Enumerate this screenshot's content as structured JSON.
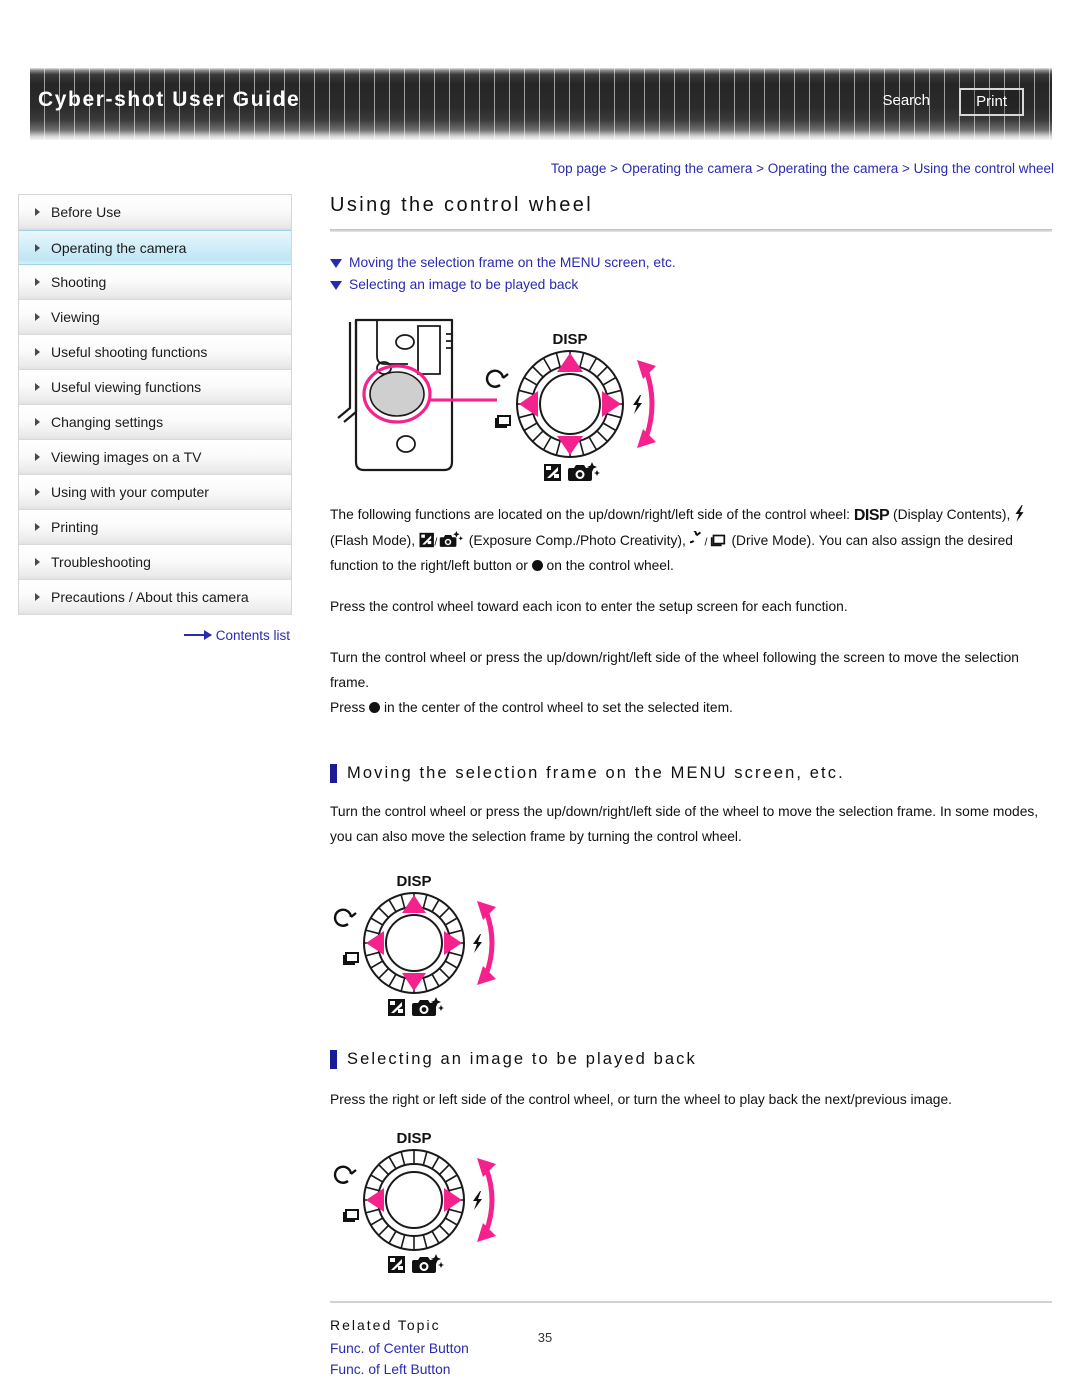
{
  "header": {
    "title": "Cyber-shot User Guide",
    "search_label": "Search",
    "print_label": "Print"
  },
  "breadcrumb": "Top page > Operating the camera > Operating the camera > Using the control wheel",
  "sidebar": {
    "items": [
      {
        "label": "Before Use",
        "active": false
      },
      {
        "label": "Operating the camera",
        "active": true
      },
      {
        "label": "Shooting",
        "active": false
      },
      {
        "label": "Viewing",
        "active": false
      },
      {
        "label": "Useful shooting functions",
        "active": false
      },
      {
        "label": "Useful viewing functions",
        "active": false
      },
      {
        "label": "Changing settings",
        "active": false
      },
      {
        "label": "Viewing images on a TV",
        "active": false
      },
      {
        "label": "Using with your computer",
        "active": false
      },
      {
        "label": "Printing",
        "active": false
      },
      {
        "label": "Troubleshooting",
        "active": false
      },
      {
        "label": "Precautions / About this camera",
        "active": false
      }
    ],
    "contents_list_label": "Contents list"
  },
  "main": {
    "title": "Using the control wheel",
    "jump_links": [
      "Moving the selection frame on the MENU screen, etc.",
      "Selecting an image to be played back"
    ],
    "intro_paragraph_1_a": "The following functions are located on the up/down/right/left side of the control wheel: ",
    "intro_disp": "DISP",
    "intro_paragraph_1_b": " (Display Contents), ",
    "intro_paragraph_1_c": " (Flash Mode), ",
    "intro_paragraph_1_d": " (Exposure Comp./Photo Creativity), ",
    "intro_paragraph_1_e": " (Drive Mode). You can also assign the desired function to the right/left button or ",
    "intro_paragraph_1_f": " on the control wheel.",
    "paragraph_2": "Press the control wheel toward each icon to enter the setup screen for each function.",
    "paragraph_3": "Turn the control wheel or press the up/down/right/left side of the wheel following the screen to move the selection frame.",
    "paragraph_4_a": "Press ",
    "paragraph_4_b": " in the center of the control wheel to set the selected item.",
    "section_1": {
      "heading": "Moving the selection frame on the MENU screen, etc.",
      "paragraph": "Turn the control wheel or press the up/down/right/left side of the wheel to move the selection frame. In some modes, you can also move the selection frame by turning the control wheel."
    },
    "section_2": {
      "heading": "Selecting an image to be played back",
      "paragraph": "Press the right or left side of the control wheel, or turn the wheel to play back the next/previous image."
    },
    "related": {
      "heading": "Related Topic",
      "links": [
        "Func. of Center Button",
        "Func. of Left Button"
      ]
    },
    "page_number": "35"
  },
  "diagram": {
    "disp_label": "DISP"
  },
  "colors": {
    "accent_pink": "#F5218C",
    "link_blue": "#2a2ab0",
    "section_bar": "#1b1b96",
    "highlight": "#bfe6f4"
  }
}
